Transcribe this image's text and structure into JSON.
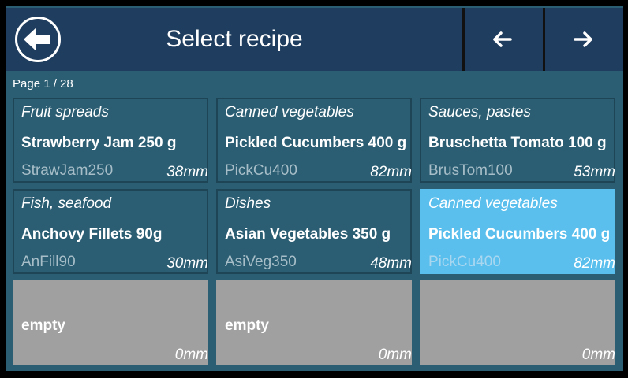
{
  "header": {
    "title": "Select recipe",
    "back_icon": "arrow-left-circle-icon",
    "prev_icon": "arrow-left-icon",
    "next_icon": "arrow-right-icon"
  },
  "page_info": "Page 1 / 28",
  "colors": {
    "header_bg": "#1f3d5e",
    "panel_bg": "#2b5e73",
    "selected_bg": "#5bbfed",
    "empty_bg": "#a0a0a0"
  },
  "cards": [
    {
      "category": "Fruit spreads",
      "name": "Strawberry Jam 250 g",
      "code": "StrawJam250",
      "size": "38mm",
      "state": "normal"
    },
    {
      "category": "Canned vegetables",
      "name": "Pickled Cucumbers 400 g",
      "code": "PickCu400",
      "size": "82mm",
      "state": "normal"
    },
    {
      "category": "Sauces, pastes",
      "name": "Bruschetta Tomato 100 g",
      "code": "BrusTom100",
      "size": "53mm",
      "state": "normal"
    },
    {
      "category": "Fish, seafood",
      "name": "Anchovy Fillets 90g",
      "code": "AnFill90",
      "size": "30mm",
      "state": "normal"
    },
    {
      "category": "Dishes",
      "name": "Asian Vegetables 350 g",
      "code": "AsiVeg350",
      "size": "48mm",
      "state": "normal"
    },
    {
      "category": "Canned vegetables",
      "name": "Pickled Cucumbers 400 g",
      "code": "PickCu400",
      "size": "82mm",
      "state": "selected"
    },
    {
      "label": "empty",
      "size": "0mm",
      "state": "empty"
    },
    {
      "label": "empty",
      "size": "0mm",
      "state": "empty"
    },
    {
      "label": "",
      "size": "0mm",
      "state": "empty"
    }
  ]
}
